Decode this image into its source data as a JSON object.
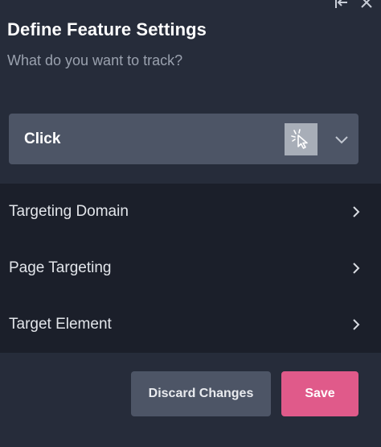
{
  "header": {
    "title": "Define Feature Settings",
    "subtitle": "What do you want to track?",
    "icons": [
      "collapse-left-icon",
      "close-icon"
    ]
  },
  "tracking_select": {
    "selected_value": "Click",
    "icon": "cursor-click-icon",
    "toggle_icon": "chevron-down-icon"
  },
  "targeting": {
    "items": [
      {
        "label": "Targeting Domain",
        "icon": "chevron-right-icon"
      },
      {
        "label": "Page Targeting",
        "icon": "chevron-right-icon"
      },
      {
        "label": "Target Element",
        "icon": "chevron-right-icon"
      }
    ]
  },
  "actions": {
    "discard_label": "Discard Changes",
    "save_label": "Save"
  },
  "colors": {
    "background": "#262c3a",
    "panel_dark": "#1b1f2a",
    "control": "#4d5566",
    "accent_save": "#e05a8a",
    "muted_text": "#9aa1ae"
  }
}
